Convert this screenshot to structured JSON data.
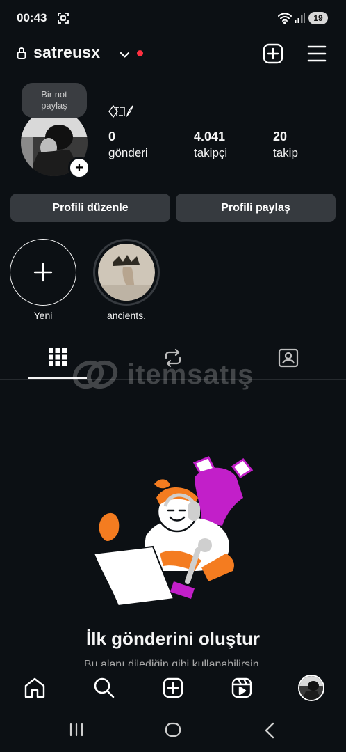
{
  "status_bar": {
    "time": "00:43",
    "battery": "19"
  },
  "header": {
    "username": "satreusx"
  },
  "note": {
    "line1": "Bir not",
    "line2": "paylaş"
  },
  "stats": [
    {
      "value": "0",
      "label": "gönderi"
    },
    {
      "value": "4.041",
      "label": "takipçi"
    },
    {
      "value": "20",
      "label": "takip"
    }
  ],
  "buttons": {
    "edit_profile": "Profili düzenle",
    "share_profile": "Profili paylaş"
  },
  "highlights": [
    {
      "label": "Yeni"
    },
    {
      "label": "ancients."
    }
  ],
  "watermark": {
    "text": "itemsatış"
  },
  "empty_state": {
    "title": "İlk gönderini oluştur",
    "subtitle": "Bu alanı dilediğin gibi kullanabilirsin."
  },
  "colors": {
    "background": "#0c1014",
    "button": "#363a3f",
    "notification": "#ff3040"
  }
}
